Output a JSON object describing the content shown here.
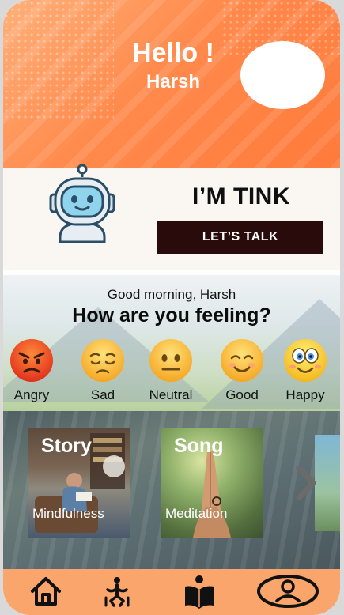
{
  "header": {
    "greeting": "Hello !",
    "name": "Harsh"
  },
  "tink": {
    "title": "I’M TINK",
    "button_label": "LET’S TALK"
  },
  "mood": {
    "greeting": "Good morning, Harsh",
    "question": "How are you feeling?",
    "emotions": [
      {
        "label": "Angry",
        "icon": "angry-face-icon"
      },
      {
        "label": "Sad",
        "icon": "sad-face-icon"
      },
      {
        "label": "Neutral",
        "icon": "neutral-face-icon"
      },
      {
        "label": "Good",
        "icon": "smiling-face-icon"
      },
      {
        "label": "Happy",
        "icon": "happy-face-icon"
      }
    ]
  },
  "activities": [
    {
      "title": "Story",
      "subtitle": "Mindfulness"
    },
    {
      "title": "Song",
      "subtitle": "Meditation"
    }
  ],
  "nav": {
    "items": [
      {
        "icon": "home-icon"
      },
      {
        "icon": "yoga-icon"
      },
      {
        "icon": "reading-icon"
      },
      {
        "icon": "profile-icon"
      }
    ]
  },
  "colors": {
    "accent": "#ff8a4c",
    "nav_bg": "#f9a56b",
    "button_bg": "#2a0b0b"
  }
}
